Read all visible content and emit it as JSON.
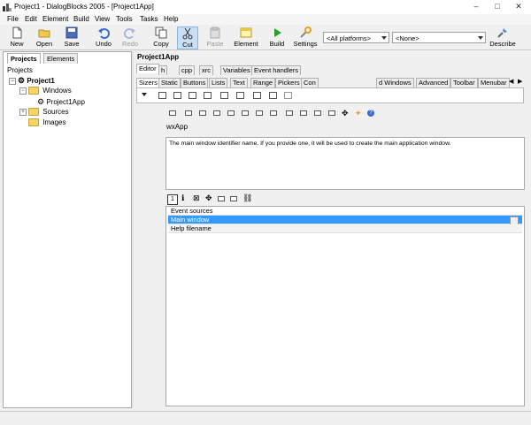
{
  "window": {
    "title": "Project1 - DialogBlocks 2005 - [Project1App]",
    "controls": {
      "minimize": "–",
      "maximize": "□",
      "close": "✕"
    }
  },
  "menu": [
    "File",
    "Edit",
    "Element",
    "Build",
    "View",
    "Tools",
    "Tasks",
    "Help"
  ],
  "toolbar": {
    "buttons": [
      {
        "label": "New",
        "icon": "new-file-icon"
      },
      {
        "label": "Open",
        "icon": "open-folder-icon"
      },
      {
        "label": "Save",
        "icon": "save-icon"
      },
      {
        "label": "Undo",
        "icon": "undo-icon"
      },
      {
        "label": "Redo",
        "icon": "redo-icon",
        "disabled": true
      },
      {
        "label": "Copy",
        "icon": "copy-icon"
      },
      {
        "label": "Cut",
        "icon": "cut-icon"
      },
      {
        "label": "Paste",
        "icon": "paste-icon",
        "disabled": true
      },
      {
        "label": "Element",
        "icon": "element-icon"
      },
      {
        "label": "Build",
        "icon": "build-icon"
      },
      {
        "label": "Settings",
        "icon": "settings-icon"
      },
      {
        "label": "Describe",
        "icon": "describe-icon"
      }
    ],
    "platform_combo": "<All platforms>",
    "config_combo": "<None>"
  },
  "left_panel": {
    "tabs": [
      "Projects",
      "Elements"
    ],
    "tree": [
      {
        "label": "Projects",
        "level": 0
      },
      {
        "label": "Project1",
        "level": 1,
        "bold": true
      },
      {
        "label": "Windows",
        "level": 2
      },
      {
        "label": "Project1App",
        "level": 3
      },
      {
        "label": "Sources",
        "level": 2
      },
      {
        "label": "Images",
        "level": 2
      }
    ]
  },
  "editor": {
    "title": "Project1App",
    "top_tabs": [
      "Editor",
      "h",
      "cpp",
      "xrc",
      "Variables",
      "Event handlers"
    ],
    "palette_tabs": [
      "Sizers",
      "Static",
      "Buttons",
      "Lists",
      "Text",
      "Range",
      "Pickers",
      "Con",
      "d Windows",
      "Advanced",
      "Toolbar",
      "Menubar"
    ],
    "app_name": "wxApp",
    "description": "The main window identifier name. If you provide one, it will be used to create the main application window.",
    "property_tab_marker": "1",
    "properties": [
      {
        "label": "Event sources",
        "selected": false
      },
      {
        "label": "Main window",
        "selected": true
      },
      {
        "label": "Help filename",
        "selected": false
      }
    ]
  },
  "colors": {
    "selection": "#3399ff",
    "accent_green": "#2aa02a",
    "folder": "#f2d46b"
  }
}
